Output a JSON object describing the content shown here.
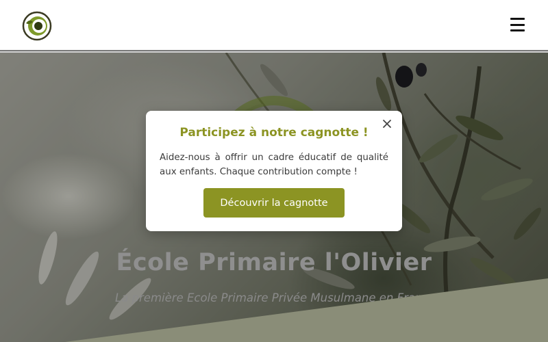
{
  "header": {
    "logo_icon": "olive-logo-icon",
    "menu_icon": "hamburger-menu-icon"
  },
  "hero": {
    "title": "École Primaire l'Olivier",
    "subtitle": "La première Ecole Primaire Privée Musulmane en France"
  },
  "modal": {
    "title": "Participez à notre cagnotte !",
    "text": "Aidez-nous à offrir un cadre éducatif de qualité aux enfants. Chaque contribution compte !",
    "button_label": "Découvrir la cagnotte",
    "close_icon": "close-icon"
  },
  "colors": {
    "accent": "#8c9423",
    "diagonal_band": "#8a8d78",
    "header_bg": "#ffffff"
  }
}
